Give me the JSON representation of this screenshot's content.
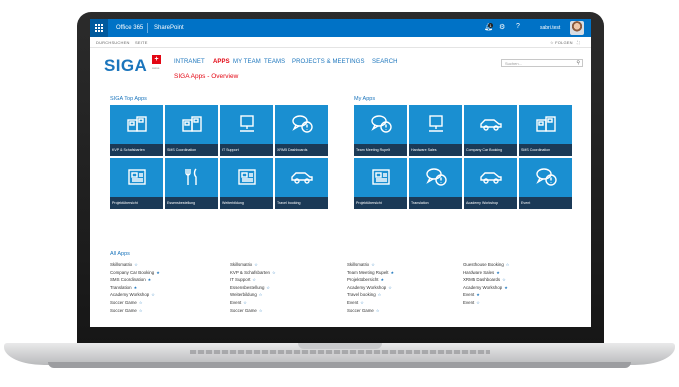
{
  "suite": {
    "brand": "Office 365",
    "app": "SharePoint",
    "notification_count": "1",
    "user": "sabri.test"
  },
  "ribbon": {
    "browse": "DURCHSUCHEN",
    "site": "SEITE",
    "follow": "☆ FOLGEN",
    "focus": "⛶"
  },
  "site": {
    "logo": "SIGA",
    "logo_badge": "+",
    "logo_sub": "swiss",
    "nav": [
      "INTRANET",
      "APPS",
      "MY TEAM",
      "TEAMS",
      "PROJECTS & MEETINGS",
      "SEARCH"
    ],
    "active_nav": "APPS",
    "page_title": "SIGA Apps - Overview",
    "search_placeholder": "Suchen..."
  },
  "top_apps": {
    "title": "SIGA Top Apps",
    "tiles": [
      {
        "label": "KVP & Schafsbarten",
        "icon": "cards-icon"
      },
      {
        "label": "SMS Coordination",
        "icon": "cards-icon"
      },
      {
        "label": "IT Support",
        "icon": "computer-icon"
      },
      {
        "label": "XRM5 Dashboards",
        "icon": "chat-bubbles-icon"
      },
      {
        "label": "Projektübersicht",
        "icon": "document-icon"
      },
      {
        "label": "Essensbestellung",
        "icon": "cutlery-icon"
      },
      {
        "label": "Weiterbildung",
        "icon": "document-icon"
      },
      {
        "label": "Travel booking",
        "icon": "car-icon"
      }
    ]
  },
  "my_apps": {
    "title": "My Apps",
    "tiles": [
      {
        "label": "Team Meeting Rupelt",
        "icon": "chat-bubbles-icon"
      },
      {
        "label": "Hardware Sales",
        "icon": "computer-icon"
      },
      {
        "label": "Company Car Booking",
        "icon": "car-icon"
      },
      {
        "label": "SMS Coordination",
        "icon": "cards-icon"
      },
      {
        "label": "Projektübersicht",
        "icon": "document-icon"
      },
      {
        "label": "Translation",
        "icon": "chat-bubbles-icon"
      },
      {
        "label": "Academy Workshop",
        "icon": "car-icon"
      },
      {
        "label": "Event",
        "icon": "chat-bubbles-icon"
      }
    ]
  },
  "all_apps": {
    "title": "All Apps",
    "columns": [
      [
        {
          "label": "Skillsmatrix",
          "mark": "☆"
        },
        {
          "label": "Company Car Booking",
          "mark": "★"
        },
        {
          "label": "SMS Coordination",
          "mark": "★"
        },
        {
          "label": "Translation",
          "mark": "★"
        },
        {
          "label": "Academy Workshop",
          "mark": "☆"
        },
        {
          "label": "Soccer Game",
          "mark": "☆"
        },
        {
          "label": "Soccer Game",
          "mark": "☆"
        }
      ],
      [
        {
          "label": "Skillsmatrix",
          "mark": "☆"
        },
        {
          "label": "KVP & Schafsbarten",
          "mark": "☆"
        },
        {
          "label": "IT Support",
          "mark": "☆"
        },
        {
          "label": "Essensbestellung",
          "mark": "☆"
        },
        {
          "label": "Weiterbildung",
          "mark": "☆"
        },
        {
          "label": "Event",
          "mark": "☆"
        },
        {
          "label": "Soccer Game",
          "mark": "☆"
        }
      ],
      [
        {
          "label": "Skillsmatrix",
          "mark": "☆"
        },
        {
          "label": "Team Meeting Rupelt",
          "mark": "★"
        },
        {
          "label": "Projektübersicht",
          "mark": "★"
        },
        {
          "label": "Academy Workshop",
          "mark": "☆"
        },
        {
          "label": "Travel booking",
          "mark": "☆"
        },
        {
          "label": "Event",
          "mark": "☆"
        },
        {
          "label": "Soccer Game",
          "mark": "☆"
        }
      ],
      [
        {
          "label": "Guesthouse Booking",
          "mark": "☆"
        },
        {
          "label": "Hardware Sales",
          "mark": "★"
        },
        {
          "label": "XRM5 Dashboards",
          "mark": "☆"
        },
        {
          "label": "Academy Workshop",
          "mark": "★"
        },
        {
          "label": "Event",
          "mark": "★"
        },
        {
          "label": "Event",
          "mark": "☆"
        }
      ]
    ]
  },
  "colors": {
    "suite_blue": "#0072c6",
    "tile_blue": "#1a8fd1",
    "tile_caption": "#1b3a57",
    "accent_red": "#e30613",
    "link_blue": "#1b75bc"
  }
}
